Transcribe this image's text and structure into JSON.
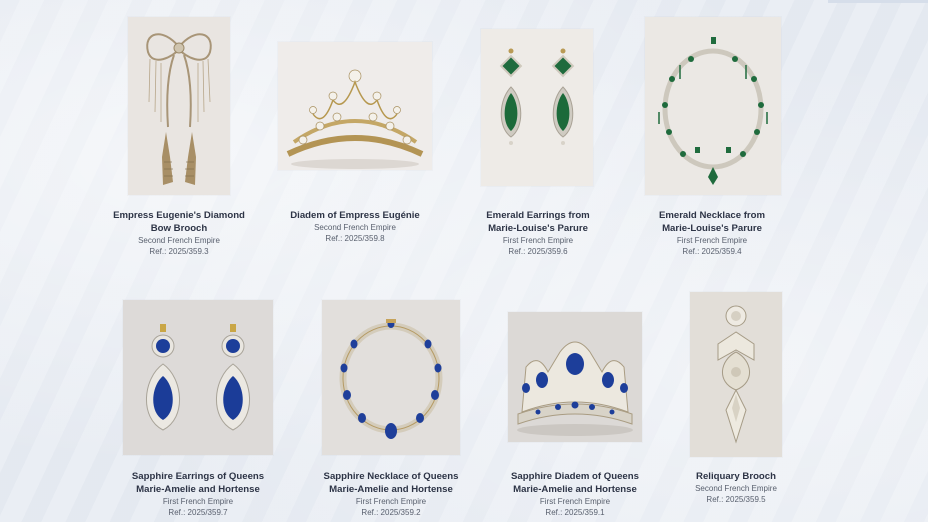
{
  "items": [
    {
      "title": "Empress Eugenie's Diamond Bow Brooch",
      "title_lines": [
        "Empress Eugenie's Diamond",
        "Bow Brooch"
      ],
      "era": "Second French Empire",
      "ref": "Ref.: 2025/359.3",
      "icon": "bow-brooch-image"
    },
    {
      "title": "Diadem of Empress Eugénie",
      "title_lines": [
        "Diadem of Empress Eugénie",
        ""
      ],
      "era": "Second French Empire",
      "ref": "Ref.: 2025/359.8",
      "icon": "diadem-image"
    },
    {
      "title": "Emerald Earrings from Marie-Louise's Parure",
      "title_lines": [
        "Emerald Earrings from",
        "Marie-Louise's Parure"
      ],
      "era": "First French Empire",
      "ref": "Ref.: 2025/359.6",
      "icon": "emerald-earrings-image"
    },
    {
      "title": "Emerald Necklace from Marie-Louise's Parure",
      "title_lines": [
        "Emerald Necklace from",
        "Marie-Louise's Parure"
      ],
      "era": "First French Empire",
      "ref": "Ref.: 2025/359.4",
      "icon": "emerald-necklace-image"
    },
    {
      "title": "Sapphire Earrings of Queens Marie-Amelie and Hortense",
      "title_lines": [
        "Sapphire Earrings of Queens",
        "Marie-Amelie and Hortense"
      ],
      "era": "First French Empire",
      "ref": "Ref.: 2025/359.7",
      "icon": "sapphire-earrings-image"
    },
    {
      "title": "Sapphire Necklace of Queens Marie-Amelie and Hortense",
      "title_lines": [
        "Sapphire Necklace of Queens",
        "Marie-Amelie and Hortense"
      ],
      "era": "First French Empire",
      "ref": "Ref.: 2025/359.2",
      "icon": "sapphire-necklace-image"
    },
    {
      "title": "Sapphire Diadem of Queens Marie-Amelie and Hortense",
      "title_lines": [
        "Sapphire Diadem of Queens",
        "Marie-Amelie and Hortense"
      ],
      "era": "First French Empire",
      "ref": "Ref.: 2025/359.1",
      "icon": "sapphire-diadem-image"
    },
    {
      "title": "Reliquary Brooch",
      "title_lines": [
        "Reliquary Brooch",
        ""
      ],
      "era": "Second French Empire",
      "ref": "Ref.: 2025/359.5",
      "icon": "reliquary-brooch-image"
    }
  ],
  "colors": {
    "background": "#e9edf3",
    "title_text": "#2d3446",
    "meta_text": "#59606e",
    "emerald": "#1f6b3d",
    "sapphire": "#1f3f96",
    "gold": "#b89a55"
  }
}
